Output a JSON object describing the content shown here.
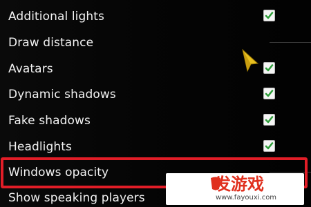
{
  "settings": {
    "items": [
      {
        "label": "Additional lights",
        "control": "checkbox",
        "checked": true
      },
      {
        "label": "Draw distance",
        "control": "slider"
      },
      {
        "label": "Avatars",
        "control": "checkbox",
        "checked": true
      },
      {
        "label": "Dynamic shadows",
        "control": "checkbox",
        "checked": true
      },
      {
        "label": "Fake shadows",
        "control": "checkbox",
        "checked": true
      },
      {
        "label": "Headlights",
        "control": "checkbox",
        "checked": true
      },
      {
        "label": "Windows opacity",
        "control": "slider"
      },
      {
        "label": "Show speaking players",
        "control": "checkbox",
        "checked": true
      }
    ],
    "highlighted_item": "Windows opacity"
  },
  "watermark": {
    "brand": "发游戏",
    "url": "www.fayouxi.com"
  },
  "colors": {
    "background": "#000000",
    "text": "#f2f2f2",
    "checkmark": "#2e9e3a",
    "highlight_border": "#e21d27",
    "cursor": "#e8c020"
  },
  "icons": {
    "checkbox": "checkbox-checked-icon",
    "cursor": "mouse-pointer-icon"
  }
}
